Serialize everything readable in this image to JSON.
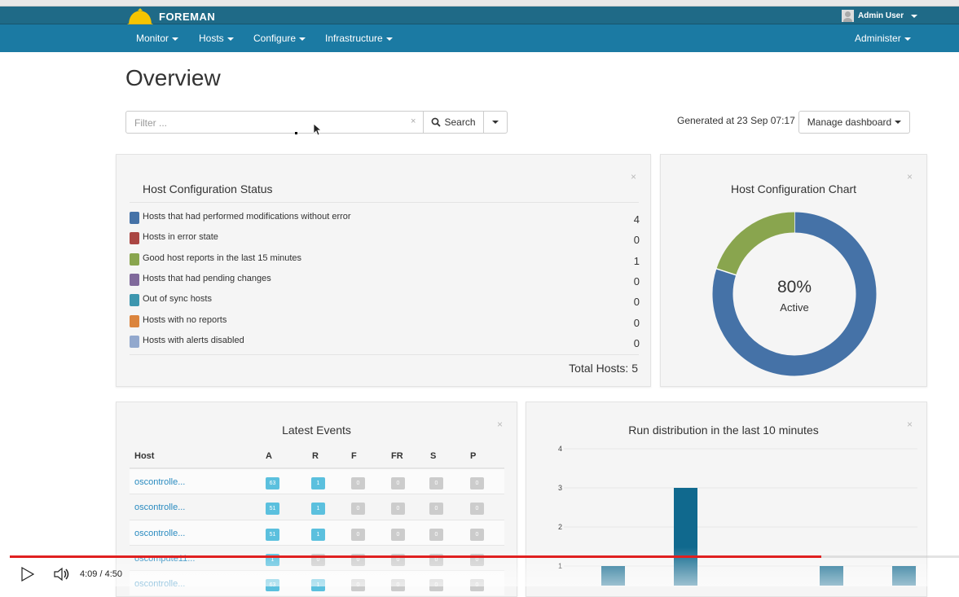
{
  "app": {
    "brand": "FOREMAN",
    "user": "Admin User"
  },
  "nav": {
    "left": [
      "Monitor",
      "Hosts",
      "Configure",
      "Infrastructure"
    ],
    "right": "Administer"
  },
  "page": {
    "title": "Overview",
    "filter_placeholder": "Filter ...",
    "search_label": "Search",
    "generated": "Generated at 23 Sep 07:17",
    "manage_label": "Manage dashboard"
  },
  "status": {
    "title": "Host Configuration Status",
    "items": [
      {
        "label": "Hosts that had performed modifications without error",
        "value": "4",
        "color": "#4572a7"
      },
      {
        "label": "Hosts in error state",
        "value": "0",
        "color": "#aa4643"
      },
      {
        "label": "Good host reports in the last 15 minutes",
        "value": "1",
        "color": "#89a54e"
      },
      {
        "label": "Hosts that had pending changes",
        "value": "0",
        "color": "#80699b"
      },
      {
        "label": "Out of sync hosts",
        "value": "0",
        "color": "#3d96ae"
      },
      {
        "label": "Hosts with no reports",
        "value": "0",
        "color": "#db843d"
      },
      {
        "label": "Hosts with alerts disabled",
        "value": "0",
        "color": "#92a8cd"
      }
    ],
    "total": "Total Hosts: 5"
  },
  "donut": {
    "title": "Host Configuration Chart",
    "percent": "80%",
    "label": "Active"
  },
  "events": {
    "title": "Latest Events",
    "columns": [
      "Host",
      "A",
      "R",
      "F",
      "FR",
      "S",
      "P"
    ],
    "rows": [
      {
        "host": "oscontrolle...",
        "vals": [
          "63",
          "1",
          "0",
          "0",
          "0",
          "0"
        ]
      },
      {
        "host": "oscontrolle...",
        "vals": [
          "51",
          "1",
          "0",
          "0",
          "0",
          "0"
        ]
      },
      {
        "host": "oscontrolle...",
        "vals": [
          "51",
          "1",
          "0",
          "0",
          "0",
          "0"
        ]
      },
      {
        "host": "oscompute11...",
        "vals": [
          "1",
          "0",
          "0",
          "0",
          "0",
          "0"
        ]
      },
      {
        "host": "oscontrolle...",
        "vals": [
          "63",
          "1",
          "0",
          "0",
          "0",
          "0"
        ]
      }
    ]
  },
  "chart_data": {
    "type": "bar",
    "title": "Run distribution in the last 10 minutes",
    "ylim": [
      0,
      4
    ],
    "yticks": [
      "4",
      "3",
      "2",
      "1"
    ],
    "values": [
      1,
      3,
      1,
      1
    ],
    "color": "#10698e"
  },
  "player": {
    "time": "4:09 / 4:50",
    "progress": 0.855
  }
}
